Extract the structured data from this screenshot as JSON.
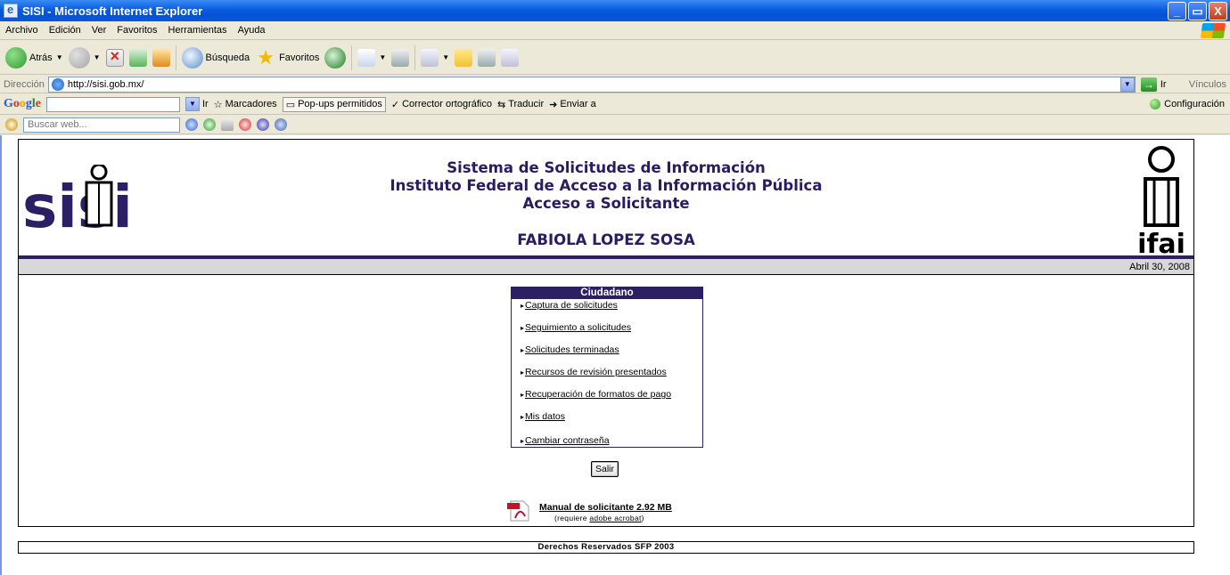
{
  "window": {
    "title": "SISI - Microsoft Internet Explorer",
    "buttons": [
      "_",
      "▭",
      "X"
    ]
  },
  "menu": [
    "Archivo",
    "Edición",
    "Ver",
    "Favoritos",
    "Herramientas",
    "Ayuda"
  ],
  "toolbar": {
    "back_label": "Atrás",
    "search_label": "Búsqueda",
    "favorites_label": "Favoritos"
  },
  "address": {
    "label": "Dirección",
    "url": "http://sisi.gob.mx/",
    "go_label": "Ir",
    "links_label": "Vínculos"
  },
  "google": {
    "logo": "Google",
    "go_label": "Ir",
    "bookmarks_label": "Marcadores",
    "popups_label": "Pop-ups permitidos",
    "spell_label": "Corrector ortográfico",
    "translate_label": "Traducir",
    "send_label": "Enviar a",
    "config_label": "Configuración"
  },
  "search2": {
    "placeholder": "Buscar web..."
  },
  "page": {
    "title_line1": "Sistema de Solicitudes de Información",
    "title_line2": "Instituto Federal de Acceso a la Información Pública",
    "title_line3": "Acceso a Solicitante",
    "user_name": "FABIOLA LOPEZ SOSA",
    "date": "Abril 30, 2008",
    "logo_left": "sisi",
    "logo_right": "ifai",
    "menu_title": "Ciudadano",
    "menu_items": [
      "Captura de solicitudes",
      "Seguimiento a solicitudes",
      "Solicitudes terminadas",
      "Recursos de revisión presentados",
      "Recuperación de formatos de pago",
      "Mis datos",
      "Cambiar contraseña"
    ],
    "logout_label": "Salir",
    "manual_label": "Manual de solicitante 2.92 MB",
    "requires_prefix": "(requiere ",
    "requires_link": "adobe acrobat",
    "requires_suffix": ")",
    "footer": "Derechos Reservados SFP 2003"
  },
  "colors": {
    "brand_purple": "#2d1f63",
    "xp_blue": "#0451d6",
    "date_band": "#d8d8d8"
  }
}
